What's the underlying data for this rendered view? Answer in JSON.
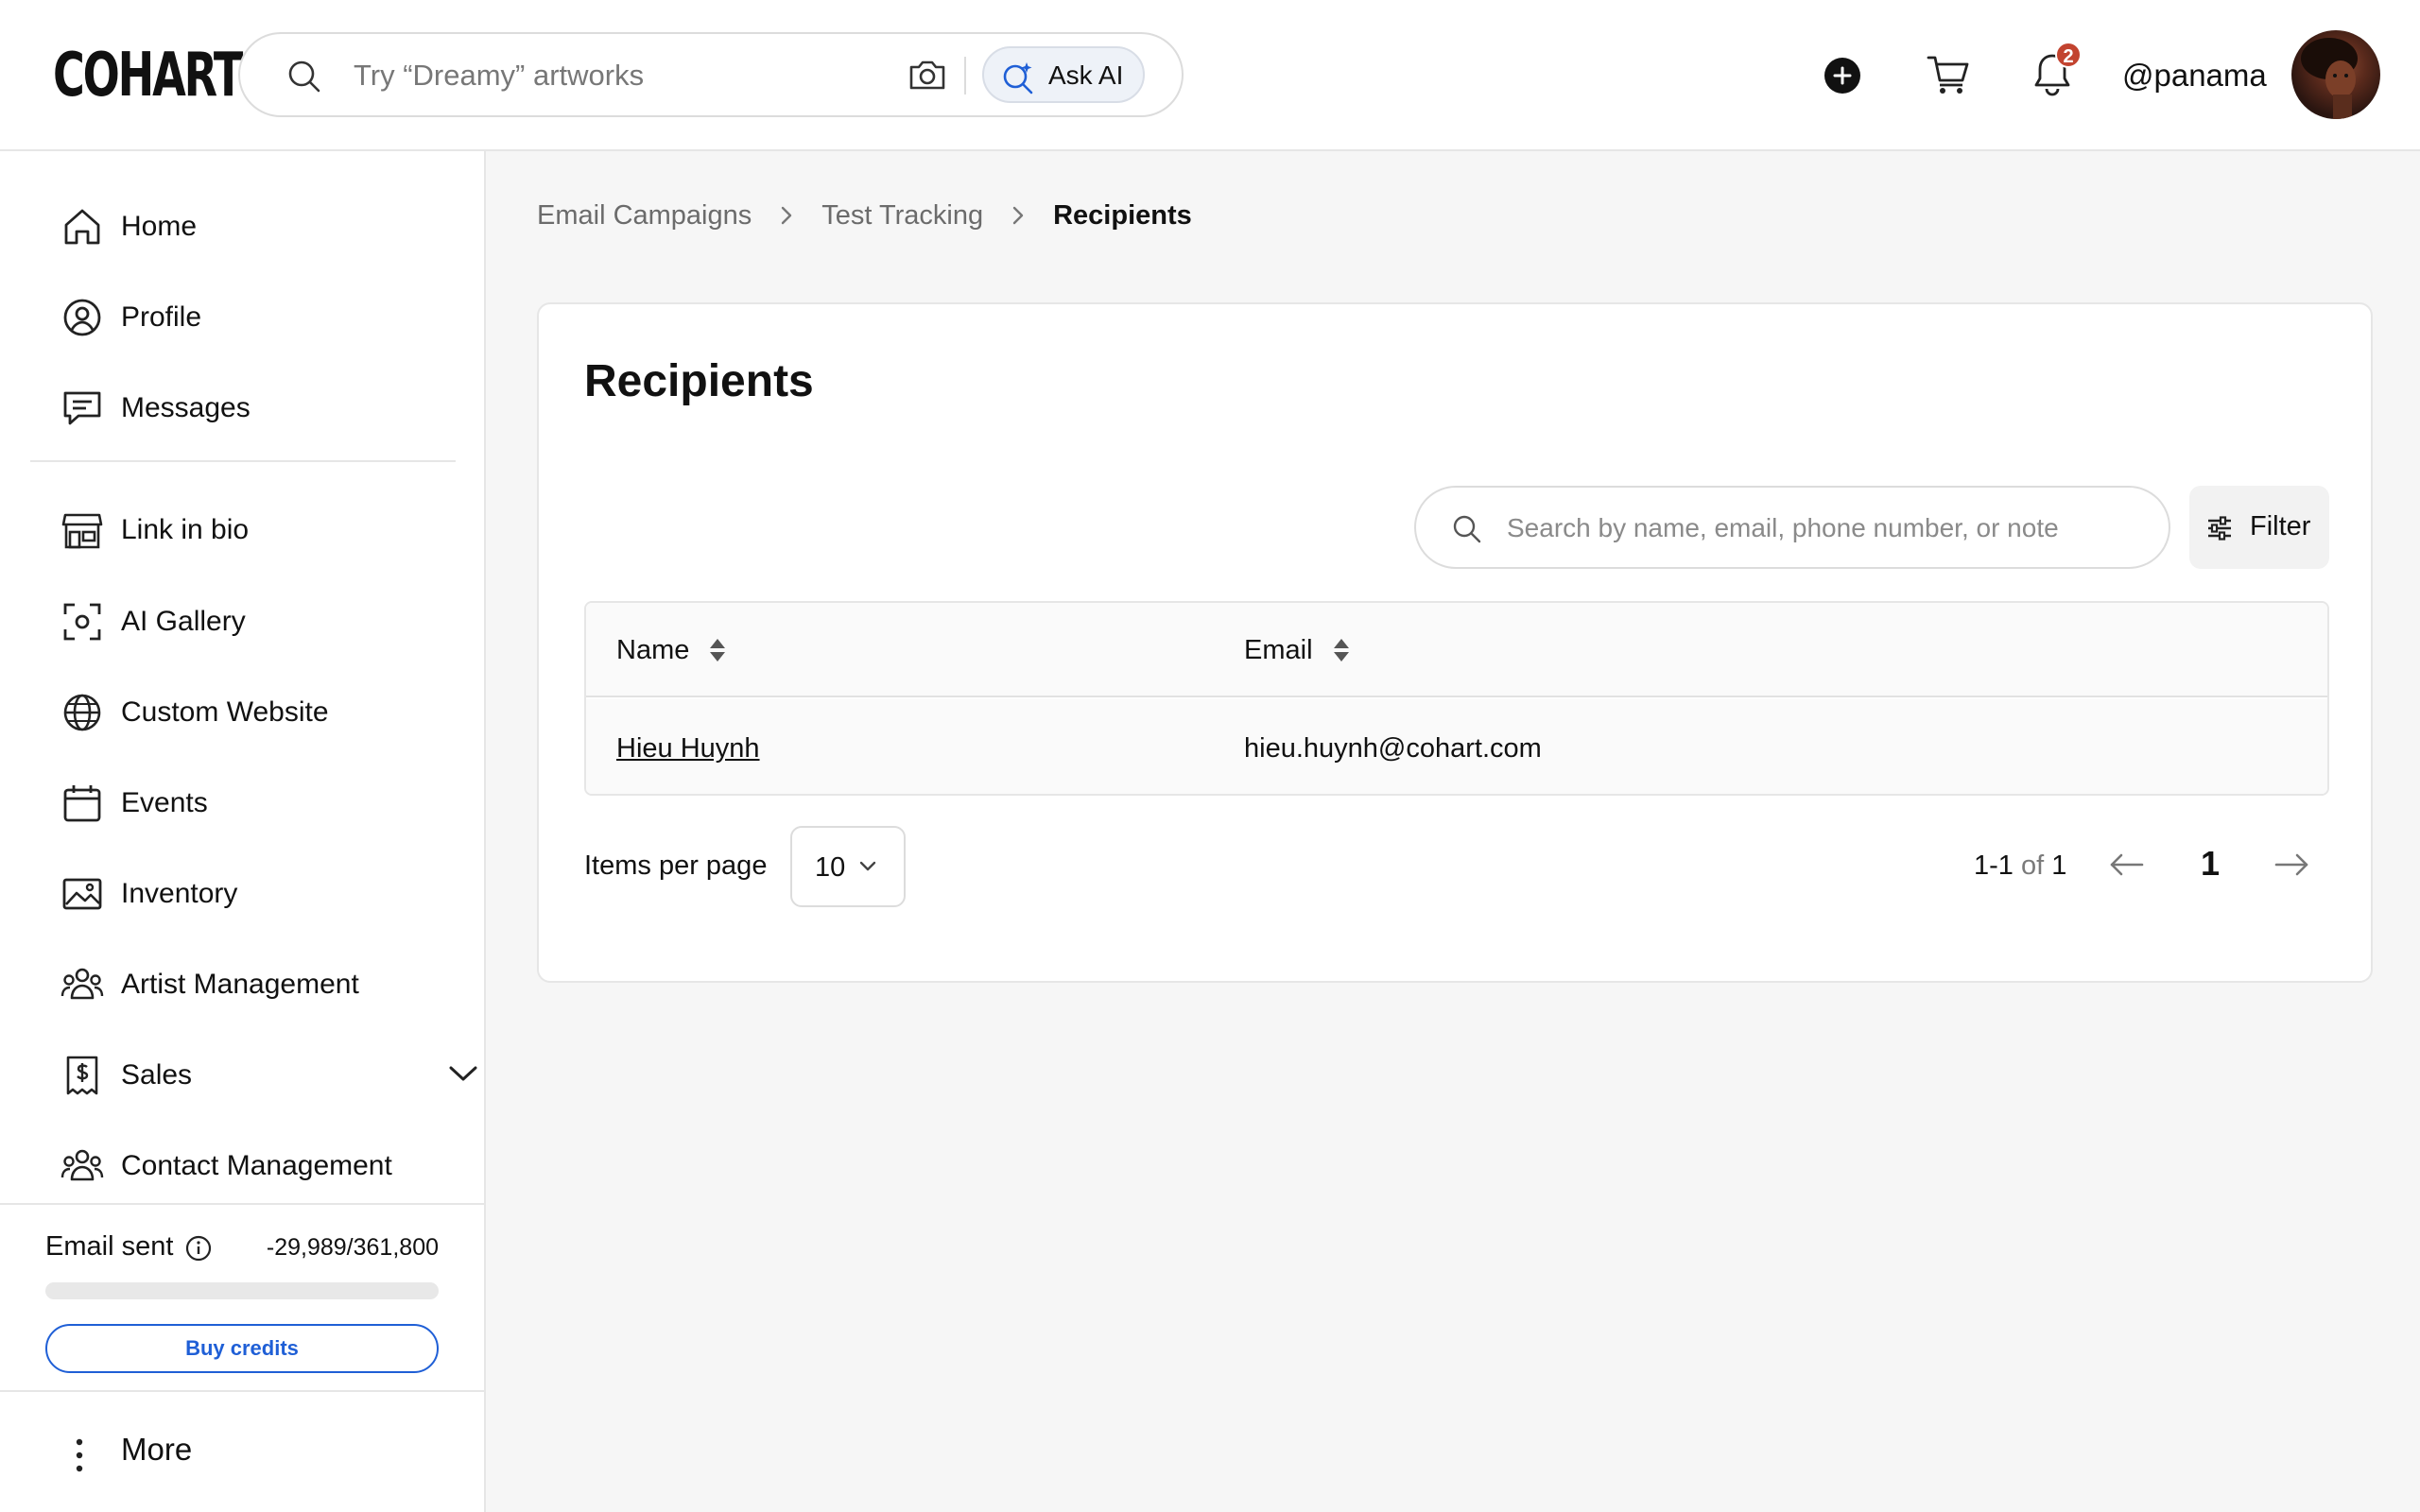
{
  "header": {
    "logo": "COHART",
    "search_placeholder": "Try “Dreamy” artworks",
    "ask_ai_label": "Ask AI",
    "notification_count": "2",
    "username": "@panama"
  },
  "sidebar": {
    "items": [
      {
        "label": "Home",
        "icon": "home-icon"
      },
      {
        "label": "Profile",
        "icon": "profile-icon"
      },
      {
        "label": "Messages",
        "icon": "messages-icon"
      },
      {
        "label": "Link in bio",
        "icon": "storefront-icon"
      },
      {
        "label": "AI Gallery",
        "icon": "scan-icon"
      },
      {
        "label": "Custom Website",
        "icon": "globe-icon"
      },
      {
        "label": "Events",
        "icon": "calendar-icon"
      },
      {
        "label": "Inventory",
        "icon": "image-icon"
      },
      {
        "label": "Artist Management",
        "icon": "people-icon"
      },
      {
        "label": "Sales",
        "icon": "dollar-receipt-icon"
      },
      {
        "label": "Contact Management",
        "icon": "people-icon"
      }
    ],
    "credits": {
      "label": "Email sent",
      "value": "-29,989/361,800",
      "progress_fraction": 0,
      "button_label": "Buy credits"
    },
    "more_label": "More"
  },
  "breadcrumb": [
    "Email Campaigns",
    "Test Tracking",
    "Recipients"
  ],
  "main": {
    "title": "Recipients",
    "search_placeholder": "Search by name, email, phone number, or note",
    "filter_label": "Filter",
    "columns": [
      "Name",
      "Email"
    ],
    "rows": [
      {
        "name": "Hieu Huynh",
        "email": "hieu.huynh@cohart.com"
      }
    ],
    "items_per_page_label": "Items per page",
    "items_per_page_value": "10",
    "range_start": "1-1",
    "range_of": "of",
    "range_total": "1",
    "current_page": "1"
  },
  "colors": {
    "accent_blue": "#1f5fd6",
    "badge_red": "#c2432f",
    "background": "#f6f6f6"
  }
}
